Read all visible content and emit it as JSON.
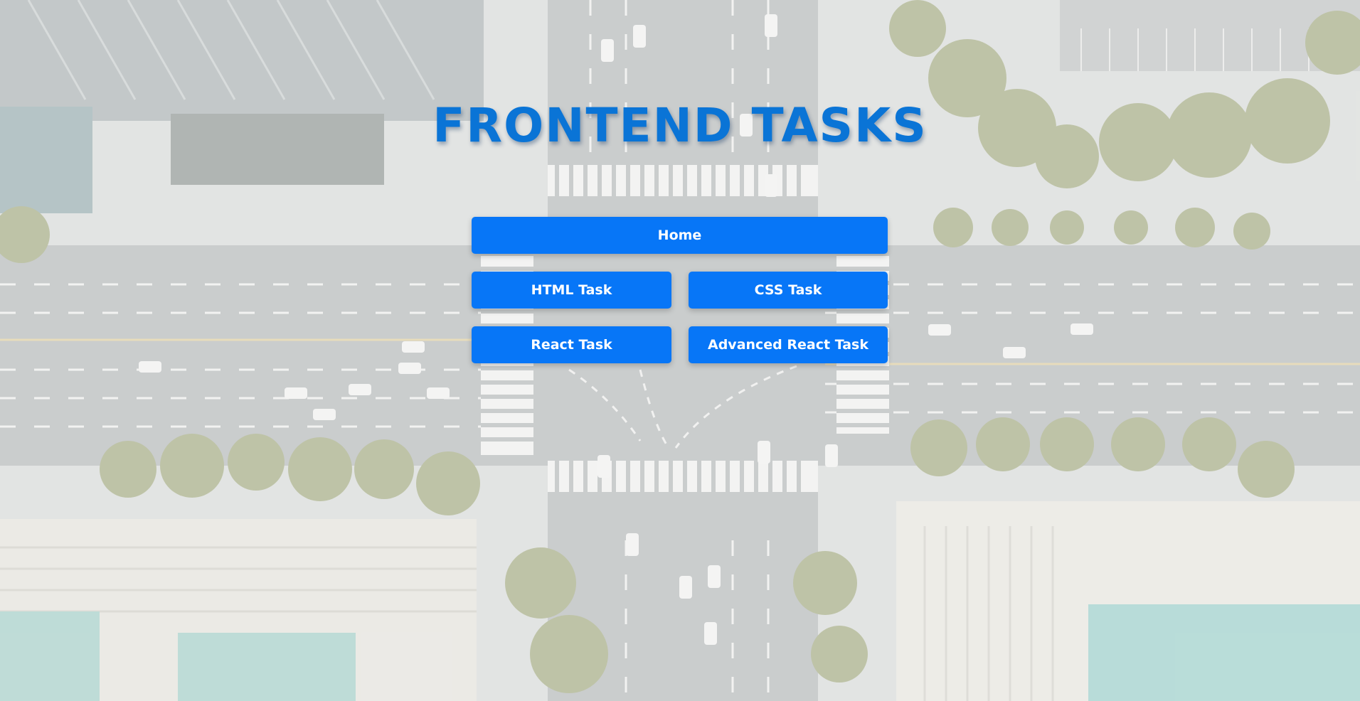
{
  "page": {
    "title": "FRONTEND TASKS"
  },
  "nav": {
    "home_label": "Home",
    "html_task_label": "HTML Task",
    "css_task_label": "CSS Task",
    "react_task_label": "React Task",
    "advanced_react_task_label": "Advanced React Task"
  },
  "colors": {
    "title": "#0a74d6",
    "button_bg": "#0776f7",
    "button_text": "#ffffff"
  }
}
